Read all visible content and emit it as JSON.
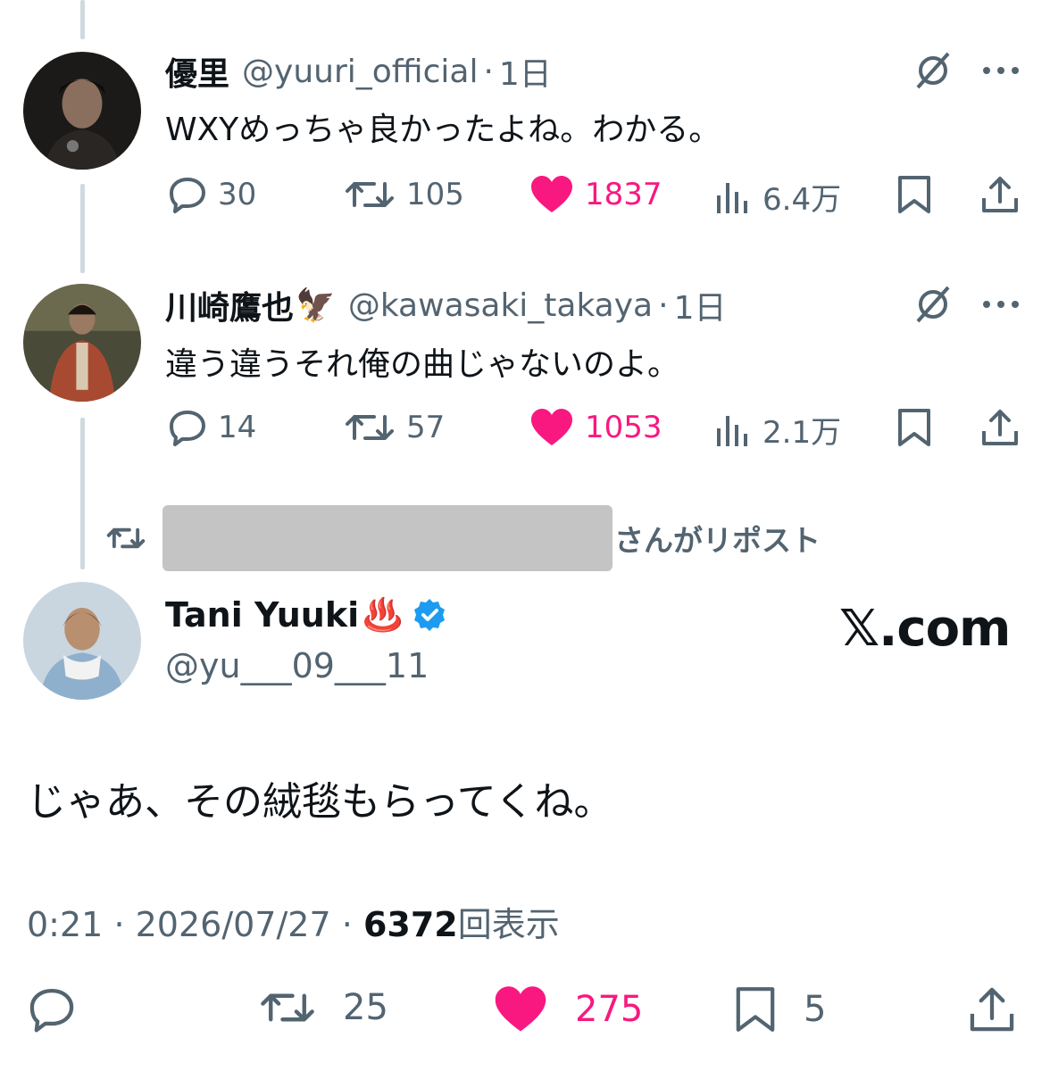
{
  "tweets": [
    {
      "name": "優里",
      "handle": "@yuuri_official",
      "separator": "·",
      "time": "1日",
      "text": "WXYめっちゃ良かったよね。わかる。",
      "replies": "30",
      "reposts": "105",
      "likes": "1837",
      "views": "6.4万"
    },
    {
      "name": "川崎鷹也",
      "name_emoji": "🦅",
      "handle": "@kawasaki_takaya",
      "separator": "·",
      "time": "1日",
      "text": "違う違うそれ俺の曲じゃないのよ。",
      "replies": "14",
      "reposts": "57",
      "likes": "1053",
      "views": "2.1万"
    }
  ],
  "repost_notice": {
    "suffix": "さんがリポスト"
  },
  "main_tweet": {
    "name": "Tani Yuuki",
    "name_emoji": "♨️",
    "handle": "@yu___09___11",
    "text": "じゃあ、その絨毯もらってくね。",
    "time": "0:21",
    "date": "2026/07/27",
    "separator": "·",
    "views": "6372",
    "views_label": "回表示",
    "reposts": "25",
    "likes": "275",
    "bookmarks": "5"
  },
  "watermark": "𝕏.com",
  "colors": {
    "like": "#f91880",
    "muted": "#536471",
    "verified": "#1d9bf0",
    "text": "#0f1419",
    "thread_line": "#cfd9de"
  }
}
